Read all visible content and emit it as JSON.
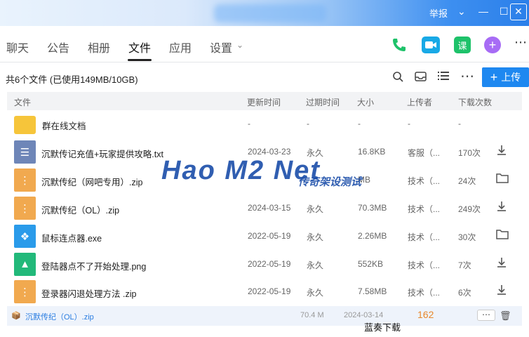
{
  "titlebar": {
    "report_label": "举报",
    "minimize_icon": "minimize-icon",
    "restore_icon": "restore-icon",
    "close_icon": "close-icon"
  },
  "nav": {
    "tabs": [
      {
        "label": "聊天"
      },
      {
        "label": "公告"
      },
      {
        "label": "相册"
      },
      {
        "label": "文件",
        "active": true
      },
      {
        "label": "应用"
      },
      {
        "label": "设置"
      }
    ],
    "settings_chevron": "chevron-down-icon",
    "apps": [
      {
        "name": "phone-icon",
        "color": "#1ec26a"
      },
      {
        "name": "video-icon",
        "color": "#18a9e6"
      },
      {
        "name": "lesson-icon",
        "label": "课",
        "color": "#1ec26a"
      },
      {
        "name": "add-app-icon",
        "label": "+",
        "color": "#a76cf5"
      }
    ]
  },
  "toolbar": {
    "summary": "共6个文件 (已使用149MB/10GB)",
    "upload_label": "上传"
  },
  "table": {
    "headers": [
      "文件",
      "更新时间",
      "过期时间",
      "大小",
      "上传者",
      "下载次数"
    ],
    "rows": [
      {
        "name": "群在线文档",
        "date": "-",
        "expire": "-",
        "size": "-",
        "uploader": "-",
        "downloads": "-",
        "icon": "folder-icon",
        "color": "#f6c53a",
        "action": ""
      },
      {
        "name": "沉默传记充值+玩家提供攻略.txt",
        "date": "2024-03-23",
        "expire": "永久",
        "size": "16.8KB",
        "uploader": "客服（...",
        "downloads": "170次",
        "icon": "text-file-icon",
        "color": "#6e86b8",
        "action": "download-icon"
      },
      {
        "name": "沉默传纪（网吧专用）.zip",
        "date": "",
        "expire": "",
        "size": "MB",
        "uploader": "技术（...",
        "downloads": "24次",
        "icon": "zip-file-icon",
        "color": "#f1a94f",
        "action": "open-folder-icon"
      },
      {
        "name": "沉默传纪（OL）.zip",
        "date": "2024-03-15",
        "expire": "永久",
        "size": "70.3MB",
        "uploader": "技术（...",
        "downloads": "249次",
        "icon": "zip-file-icon",
        "color": "#f1a94f",
        "action": "download-icon"
      },
      {
        "name": "鼠标连点器.exe",
        "date": "2022-05-19",
        "expire": "永久",
        "size": "2.26MB",
        "uploader": "技术（...",
        "downloads": "30次",
        "icon": "exe-file-icon",
        "color": "#2a9bea",
        "action": "open-folder-icon"
      },
      {
        "name": "登陆器点不了开始处理.png",
        "date": "2022-05-19",
        "expire": "永久",
        "size": "552KB",
        "uploader": "技术（...",
        "downloads": "7次",
        "icon": "image-file-icon",
        "color": "#22b97a",
        "action": "download-icon"
      },
      {
        "name": "登录器闪退处理方法 .zip",
        "date": "2022-05-19",
        "expire": "永久",
        "size": "7.58MB",
        "uploader": "技术（...",
        "downloads": "6次",
        "icon": "zip-file-icon",
        "color": "#f1a94f",
        "action": "download-icon"
      }
    ]
  },
  "watermark": {
    "main": "Hao M2 Net",
    "sub": "传奇架设测试"
  },
  "bottom": {
    "name": "沉默传纪（OL）.zip",
    "size": "70.4 M",
    "date": "2024-03-14",
    "count": "162",
    "site_label": "蓝奏下载"
  }
}
